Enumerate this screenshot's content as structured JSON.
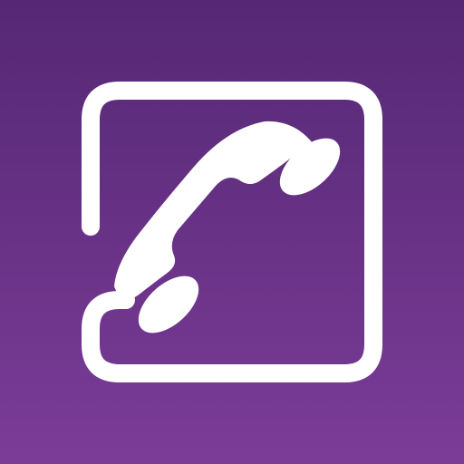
{
  "icon": {
    "name": "phone-frame-icon",
    "colors": {
      "background_top": "#552874",
      "background_bottom": "#7b3c98",
      "foreground": "#ffffff"
    }
  }
}
